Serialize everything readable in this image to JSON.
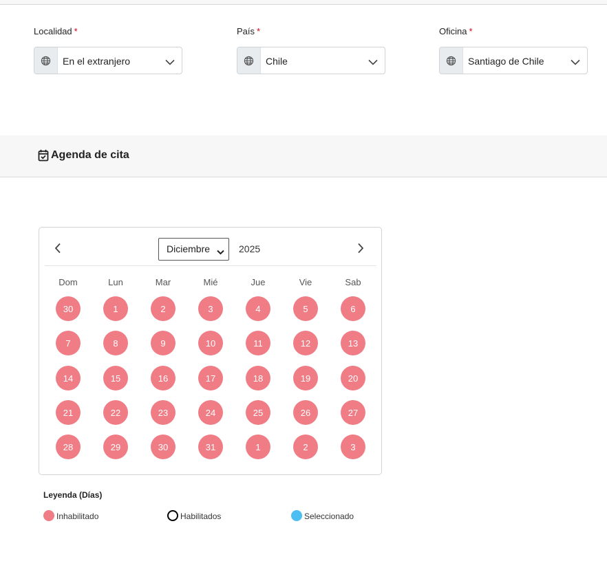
{
  "fields": [
    {
      "label": "Localidad",
      "required_mark": "*",
      "value": "En el extranjero",
      "icon": "globe-icon"
    },
    {
      "label": "País",
      "required_mark": "*",
      "value": "Chile",
      "icon": "globe-icon"
    },
    {
      "label": "Oficina",
      "required_mark": "*",
      "value": "Santiago de Chile",
      "icon": "globe-icon"
    }
  ],
  "section": {
    "title": "Agenda de cita",
    "icon": "calendar-check-icon"
  },
  "calendar": {
    "month": "Diciembre",
    "year": "2025",
    "weekdays": [
      "Dom",
      "Lun",
      "Mar",
      "Mié",
      "Jue",
      "Vie",
      "Sab"
    ],
    "weeks": [
      [
        "30",
        "1",
        "2",
        "3",
        "4",
        "5",
        "6"
      ],
      [
        "7",
        "8",
        "9",
        "10",
        "11",
        "12",
        "13"
      ],
      [
        "14",
        "15",
        "16",
        "17",
        "18",
        "19",
        "20"
      ],
      [
        "21",
        "22",
        "23",
        "24",
        "25",
        "26",
        "27"
      ],
      [
        "28",
        "29",
        "30",
        "31",
        "1",
        "2",
        "3"
      ]
    ],
    "day_state": "Inhabilitado"
  },
  "legend": {
    "title": "Leyenda (Días)",
    "items": [
      {
        "label": "Inhabilitado",
        "color": "#f07c86",
        "style": "filled"
      },
      {
        "label": "Habilitados",
        "color": "#000000",
        "style": "outline"
      },
      {
        "label": "Seleccionado",
        "color": "#4dbef2",
        "style": "filled"
      }
    ]
  },
  "colors": {
    "required": "#d0021b",
    "disabled_day": "#f07c86",
    "selected_day": "#4dbef2"
  }
}
